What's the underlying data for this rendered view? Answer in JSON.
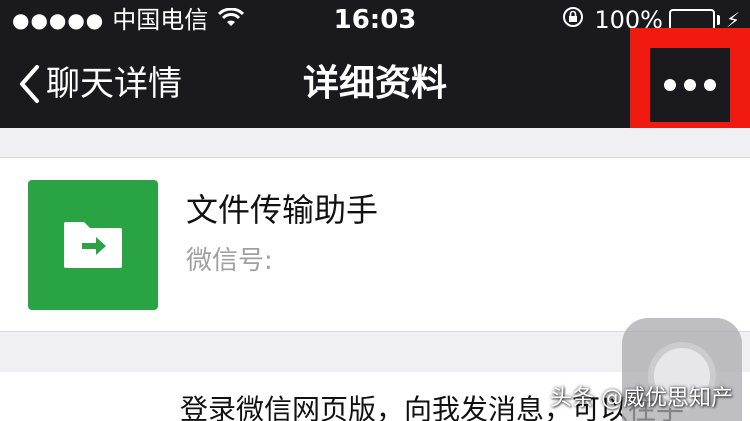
{
  "status_bar": {
    "signal_dots": "●●●●●",
    "carrier": "中国电信",
    "time": "16:03",
    "battery": "100%",
    "battery_level": 1.0
  },
  "nav": {
    "back_label": "聊天详情",
    "title": "详细资料"
  },
  "profile": {
    "name": "文件传输助手",
    "wechat_id_label": "微信号:"
  },
  "description": "登录微信网页版，向我发消息，可以往手",
  "watermark": "头条 @威优思知产",
  "colors": {
    "nav_bg": "#1a1a1e",
    "avatar_green": "#2aa345",
    "highlight_red": "#f11a10",
    "battery_green": "#4cd964"
  }
}
